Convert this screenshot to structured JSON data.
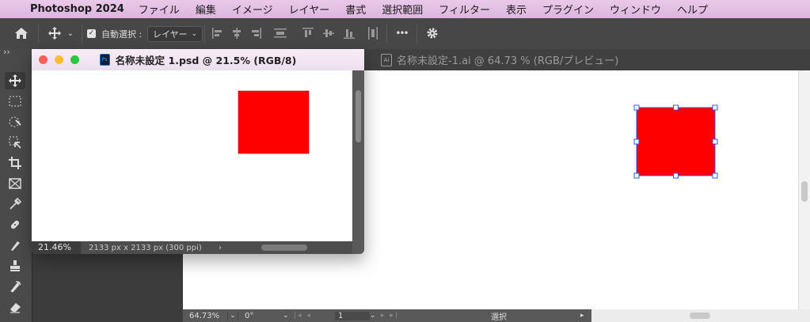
{
  "menubar": {
    "app_name": "Photoshop 2024",
    "items": [
      "ファイル",
      "編集",
      "イメージ",
      "レイヤー",
      "書式",
      "選択範囲",
      "フィルター",
      "表示",
      "プラグイン",
      "ウィンドウ",
      "ヘルプ"
    ]
  },
  "options": {
    "auto_select_label": "自動選択 :",
    "auto_select_value": "レイヤー",
    "more_label": "•••"
  },
  "panel_collapse": "››",
  "doc1": {
    "title": "名称未設定 1.psd @ 21.5% (RGB/8)",
    "badge": "Ps",
    "zoom": "21.46%",
    "info": "2133 px x 2133 px (300 ppi)",
    "arrow": "›"
  },
  "doc2": {
    "title": "名称未設定-1.ai @ 64.73 % (RGB/プレビュー)",
    "badge": "Ai",
    "zoom": "64.73%",
    "rotation": "0°",
    "artboard": "1",
    "tool": "選択"
  },
  "colors": {
    "shape": "#ff0000",
    "selection": "#3355dd"
  }
}
